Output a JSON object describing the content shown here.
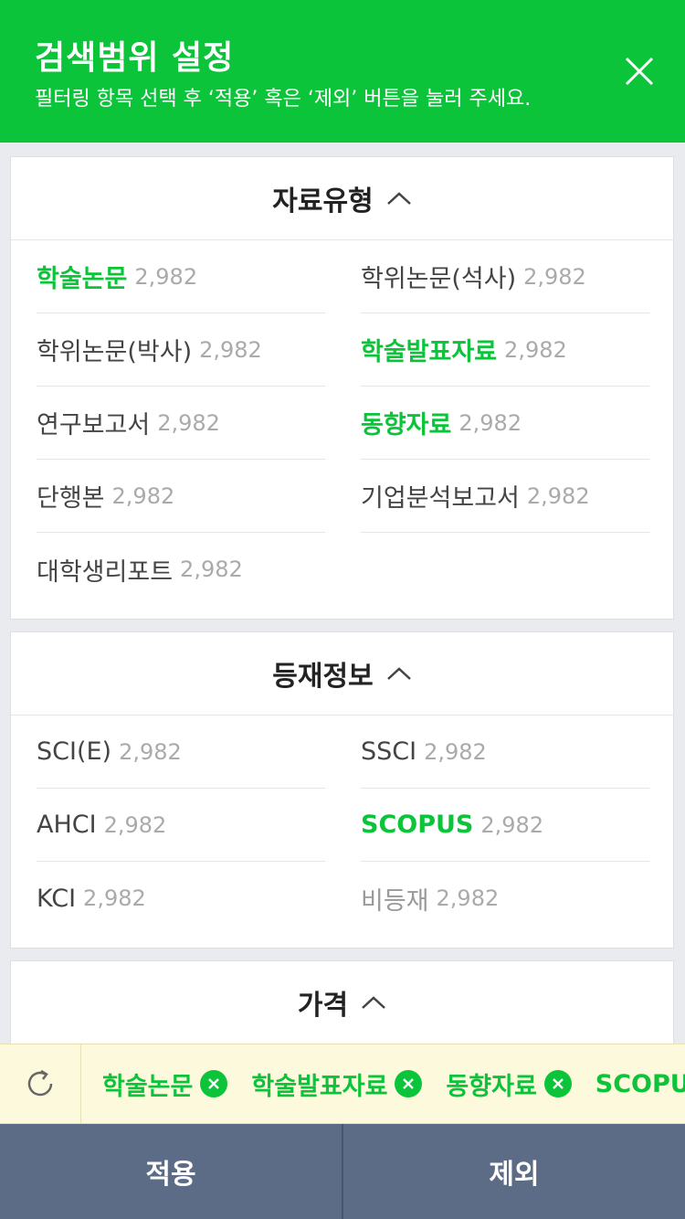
{
  "header": {
    "title": "검색범위 설정",
    "subtitle": "필터링 항목 선택 후 ‘적용’ 혹은 ‘제외’ 버튼을 눌러 주세요.",
    "close_icon": "close-icon"
  },
  "sections": {
    "type": {
      "title": "자료유형",
      "items": [
        {
          "label": "학술논문",
          "count": "2,982",
          "selected": true
        },
        {
          "label": "학위논문(석사)",
          "count": "2,982",
          "selected": false
        },
        {
          "label": "학위논문(박사)",
          "count": "2,982",
          "selected": false
        },
        {
          "label": "학술발표자료",
          "count": "2,982",
          "selected": true
        },
        {
          "label": "연구보고서",
          "count": "2,982",
          "selected": false
        },
        {
          "label": "동향자료",
          "count": "2,982",
          "selected": true
        },
        {
          "label": "단행본",
          "count": "2,982",
          "selected": false
        },
        {
          "label": "기업분석보고서",
          "count": "2,982",
          "selected": false
        },
        {
          "label": "대학생리포트",
          "count": "2,982",
          "selected": false
        }
      ]
    },
    "publication": {
      "title": "등재정보",
      "items": [
        {
          "label": "SCI(E)",
          "count": "2,982",
          "selected": false
        },
        {
          "label": "SSCI",
          "count": "2,982",
          "selected": false
        },
        {
          "label": "AHCI",
          "count": "2,982",
          "selected": false
        },
        {
          "label": "SCOPUS",
          "count": "2,982",
          "selected": true
        },
        {
          "label": "KCI",
          "count": "2,982",
          "selected": false
        },
        {
          "label": "비등재",
          "count": "2,982",
          "selected": false
        }
      ]
    },
    "price": {
      "title": "가격"
    }
  },
  "chips": {
    "reset_icon": "refresh-icon",
    "items": [
      "학술논문",
      "학술발표자료",
      "동향자료",
      "SCOPUS"
    ]
  },
  "footer": {
    "apply_label": "적용",
    "exclude_label": "제외"
  },
  "colors": {
    "accent": "#0bc43a",
    "footer": "#5d6c86",
    "chip_bar": "#fdf9dc"
  }
}
